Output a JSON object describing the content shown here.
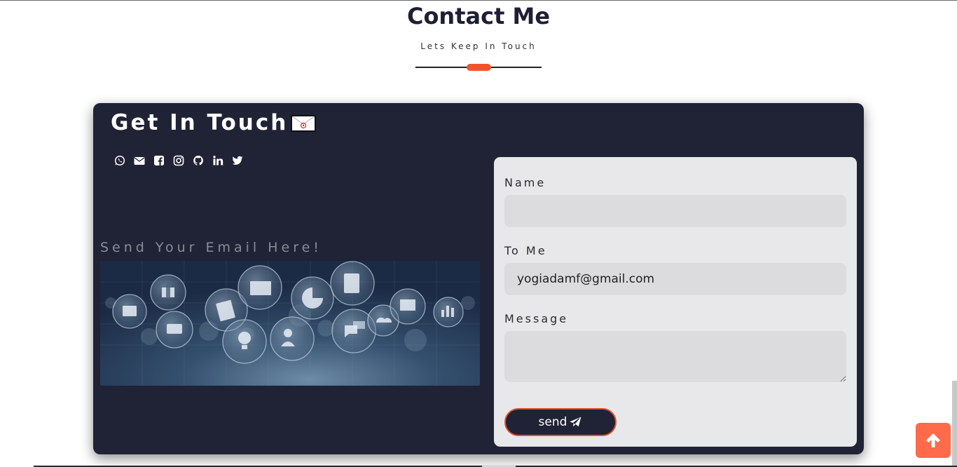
{
  "section": {
    "title": "Contact Me",
    "subtitle": "Lets Keep In Touch"
  },
  "card": {
    "title": "Get In Touch",
    "left_heading": "Send Your Email Here!",
    "socials": [
      "whatsapp-icon",
      "envelope-icon",
      "facebook-icon",
      "instagram-icon",
      "github-icon",
      "linkedin-icon",
      "twitter-icon"
    ]
  },
  "form": {
    "name_label": "Name",
    "name_value": "",
    "to_label": "To Me",
    "to_value": "yogiadamf@gmail.com",
    "message_label": "Message",
    "message_value": "",
    "send_label": "send"
  },
  "colors": {
    "accent": "#f2522e",
    "card_bg": "#202236",
    "form_bg": "#e8e8ea",
    "totop_bg": "#ff6a4a"
  }
}
